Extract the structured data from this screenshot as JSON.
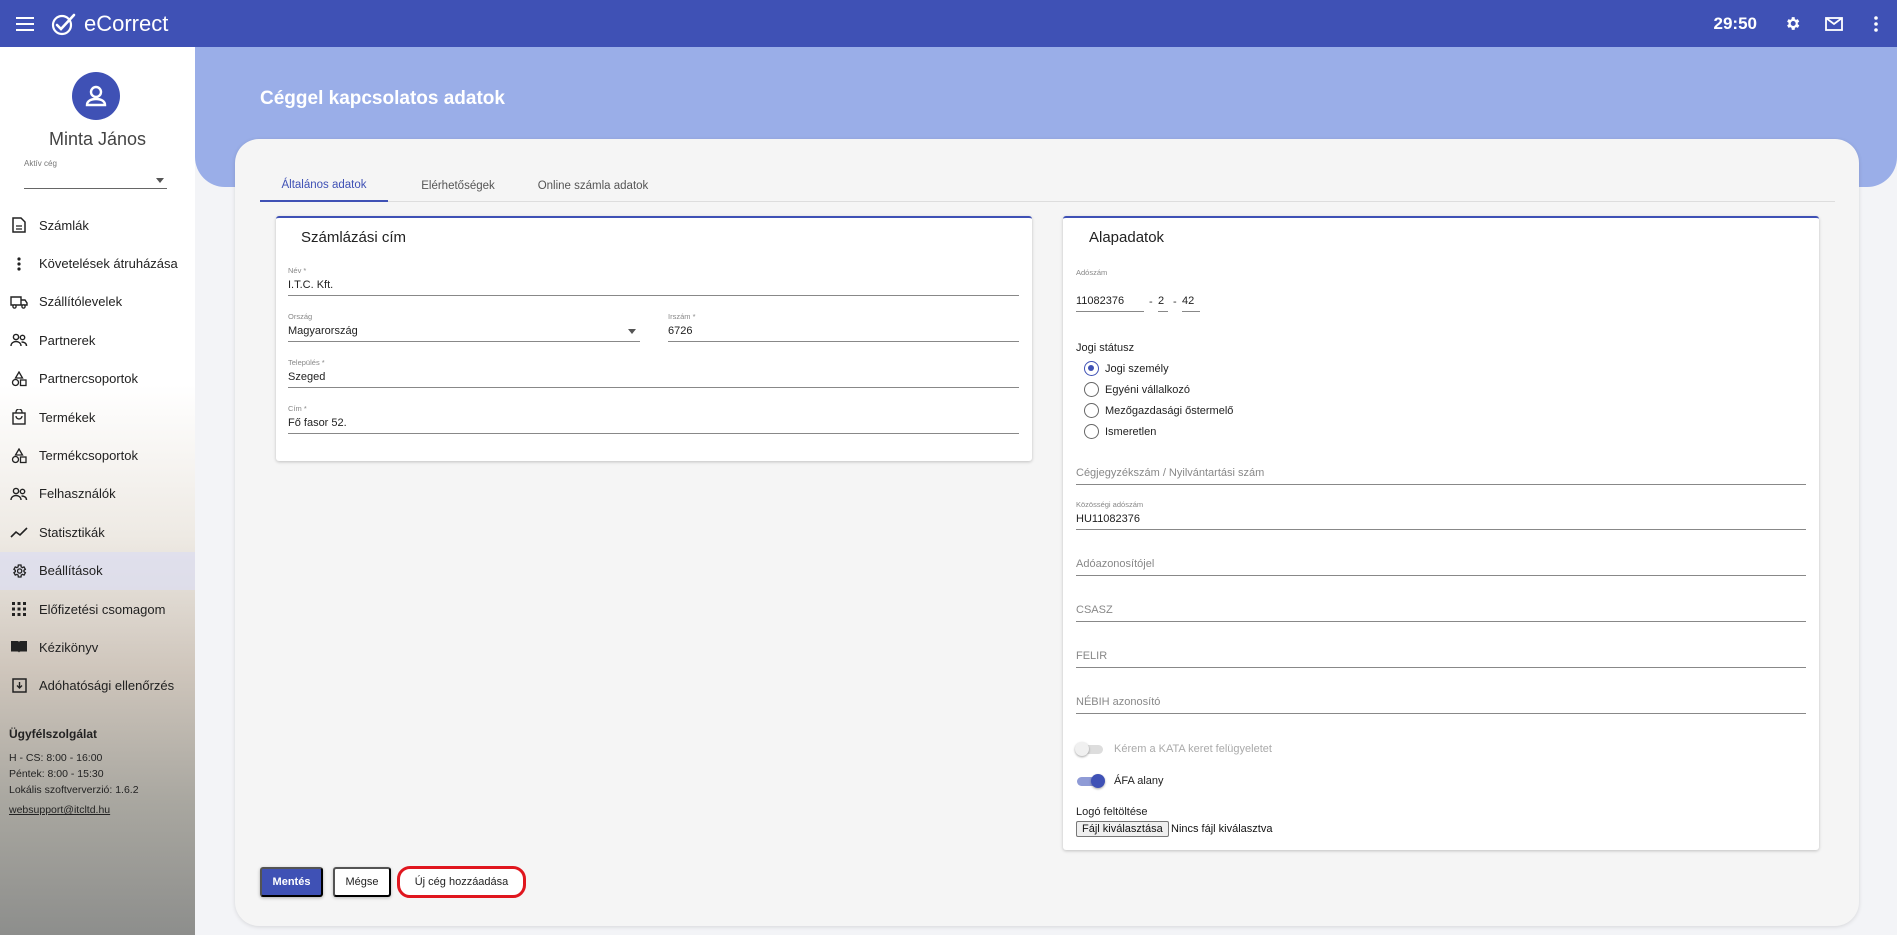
{
  "app": {
    "name": "eCorrect",
    "timer": "29:50"
  },
  "user": {
    "name": "Minta János",
    "company_label": "Aktív cég",
    "company_value": ""
  },
  "nav": [
    {
      "label": "Számlák",
      "icon": "document-icon"
    },
    {
      "label": "Követelések átruházása",
      "icon": "more-vert-icon"
    },
    {
      "label": "Szállítólevelek",
      "icon": "truck-icon"
    },
    {
      "label": "Partnerek",
      "icon": "people-icon"
    },
    {
      "label": "Partnercsoportok",
      "icon": "shapes-icon"
    },
    {
      "label": "Termékek",
      "icon": "shopping-bag-icon"
    },
    {
      "label": "Termékcsoportok",
      "icon": "shapes-icon"
    },
    {
      "label": "Felhasználók",
      "icon": "people-icon"
    },
    {
      "label": "Statisztikák",
      "icon": "trending-icon"
    },
    {
      "label": "Beállítások",
      "icon": "gear-icon"
    },
    {
      "label": "Előfizetési csomagom",
      "icon": "grid-icon"
    },
    {
      "label": "Kézikönyv",
      "icon": "book-icon"
    },
    {
      "label": "Adóhatósági ellenőrzés",
      "icon": "archive-icon"
    }
  ],
  "support": {
    "title": "Ügyfélszolgálat",
    "hours1": "H - CS: 8:00 - 16:00",
    "hours2": "Péntek: 8:00 - 15:30",
    "version": "Lokális szoftververzió: 1.6.2",
    "email": "websupport@itcltd.hu"
  },
  "page": {
    "title": "Céggel kapcsolatos adatok"
  },
  "tabs": [
    "Általános adatok",
    "Elérhetőségek",
    "Online számla adatok"
  ],
  "billing": {
    "title": "Számlázási cím",
    "name_label": "Név *",
    "name_value": "I.T.C. Kft.",
    "country_label": "Ország",
    "country_value": "Magyarország",
    "zip_label": "Irszám *",
    "zip_value": "6726",
    "city_label": "Település *",
    "city_value": "Szeged",
    "address_label": "Cím *",
    "address_value": "Fő fasor 52."
  },
  "basic": {
    "title": "Alapadatok",
    "tax_label": "Adószám",
    "tax_part1": "11082376",
    "tax_part2": "2",
    "tax_part3": "42",
    "dash": "-",
    "legal_label": "Jogi státusz",
    "legal_options": [
      "Jogi személy",
      "Egyéni vállalkozó",
      "Mezőgazdasági őstermelő",
      "Ismeretlen"
    ],
    "legal_selected": 0,
    "reg_placeholder": "Cégjegyzékszám / Nyilvántartási szám",
    "eu_tax_label": "Közösségi adószám",
    "eu_tax_value": "HU11082376",
    "taxid_placeholder": "Adóazonosítójel",
    "csasz_placeholder": "CSASZ",
    "felir_placeholder": "FELIR",
    "nebih_placeholder": "NÉBIH azonosító",
    "kata_label": "Kérem a KATA keret felügyeletet",
    "kata_on": false,
    "afa_label": "ÁFA alany",
    "afa_on": true,
    "logo_label": "Logó feltöltése",
    "file_button": "Fájl kiválasztása",
    "file_status": "Nincs fájl kiválasztva"
  },
  "actions": {
    "save": "Mentés",
    "cancel": "Mégse",
    "new_company": "Új cég hozzáadása"
  },
  "colors": {
    "primary": "#3f51b5",
    "banner": "#9aaee8",
    "highlight": "#e0161e"
  }
}
